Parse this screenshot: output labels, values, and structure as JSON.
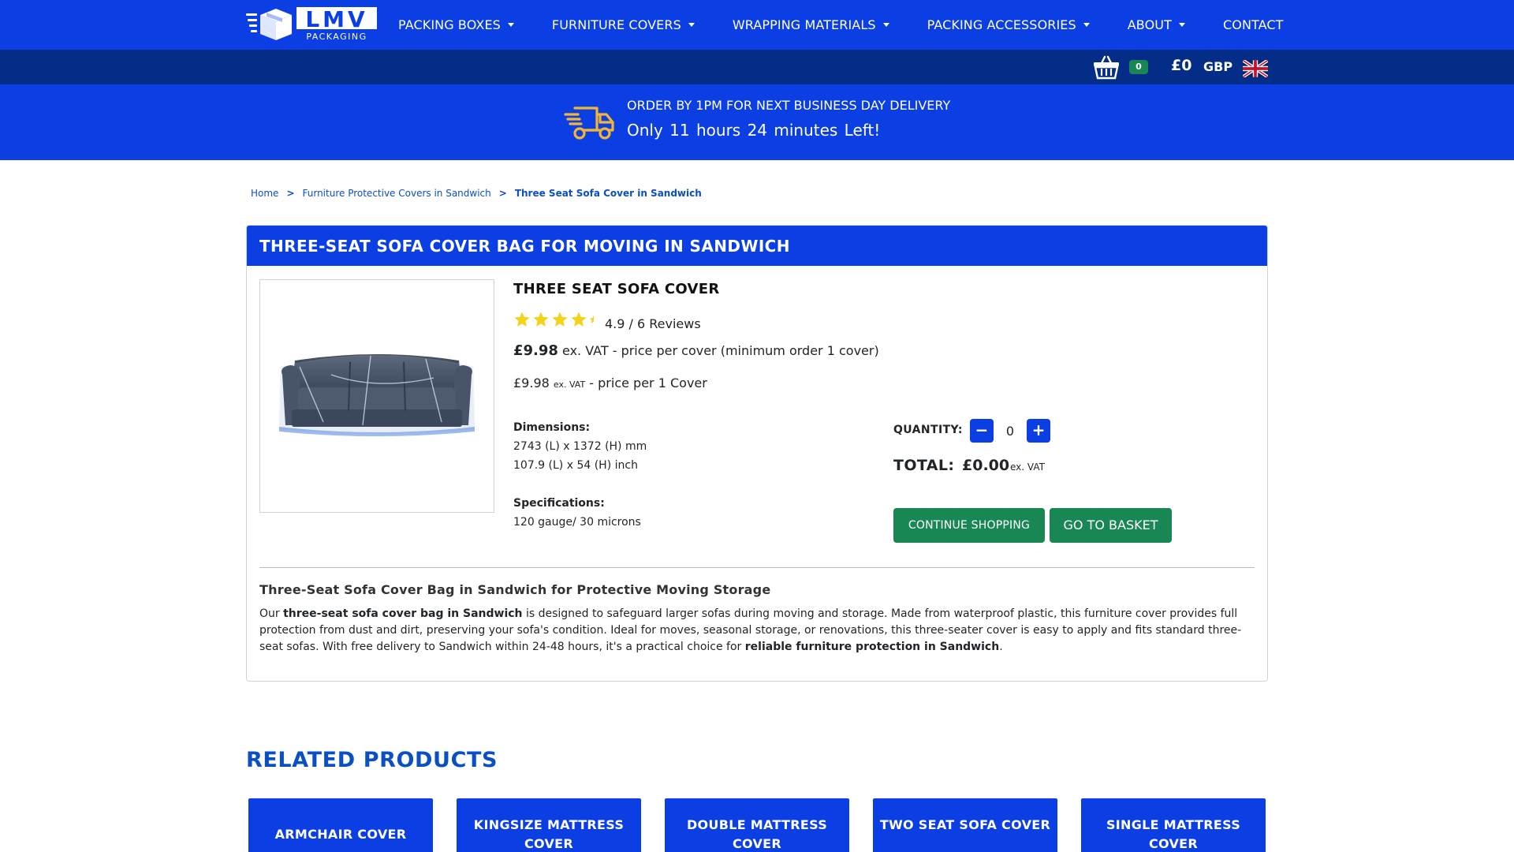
{
  "header": {
    "brand_main": "LMV",
    "brand_sub": "PACKAGING",
    "menu": [
      {
        "label": "PACKING BOXES",
        "dropdown": true
      },
      {
        "label": "FURNITURE COVERS",
        "dropdown": true
      },
      {
        "label": "WRAPPING MATERIALS",
        "dropdown": true
      },
      {
        "label": "PACKING ACCESSORIES",
        "dropdown": true
      },
      {
        "label": "ABOUT",
        "dropdown": true
      },
      {
        "label": "CONTACT",
        "dropdown": false
      }
    ]
  },
  "basket": {
    "count": "0",
    "total": "£0",
    "currency": "GBP",
    "icon": "basket-icon",
    "flag": "uk-flag-icon"
  },
  "delivery": {
    "icon": "delivery-truck-icon",
    "line1": "ORDER BY 1PM FOR NEXT BUSINESS DAY DELIVERY",
    "line2": "Only  11 hours 24 minutes  Left!"
  },
  "breadcrumb": [
    {
      "label": "Home"
    },
    {
      "label": "Furniture Protective Covers in Sandwich"
    },
    {
      "label": "Three Seat Sofa Cover in Sandwich"
    }
  ],
  "breadcrumb_sep": ">",
  "product": {
    "page_title": "THREE-SEAT SOFA COVER BAG FOR MOVING IN SANDWICH",
    "name": "THREE SEAT SOFA COVER",
    "rating": 4.9,
    "rating_text": "4.9 / 6 Reviews",
    "price": "£9.98",
    "price_suffix": " ex. VAT - price per cover (minimum order 1 cover)",
    "unit_price": "£9.98",
    "unit_exvat": "ex. VAT",
    "unit_suffix": " - price per 1 Cover",
    "dimensions_title": "Dimensions:",
    "dimensions_mm": "2743 (L) x 1372 (H) mm",
    "dimensions_inch": "107.9 (L) x 54 (H) inch",
    "spec_title": "Specifications:",
    "spec_value": "120 gauge/ 30 microns"
  },
  "order": {
    "qty_label": "QUANTITY:",
    "qty_value": "0",
    "minus": "−",
    "plus": "+",
    "total_label": "TOTAL:",
    "total_value": "£0.00",
    "total_exvat": "ex. VAT",
    "continue_label": "CONTINUE SHOPPING",
    "basket_label": "GO TO BASKET"
  },
  "description": {
    "title": "Three-Seat Sofa Cover Bag in Sandwich for Protective Moving Storage",
    "p1": "Our ",
    "b1": "three-seat sofa cover bag in Sandwich",
    "p2": " is designed to safeguard larger sofas during moving and storage. Made from waterproof plastic, this furniture cover provides full protection from dust and dirt, preserving your sofa's condition. Ideal for moves, seasonal storage, or renovations, this three-seater cover is easy to apply and fits standard three-seat sofas. With free delivery to Sandwich within 24-48 hours, it's a practical choice for ",
    "b2": "reliable furniture protection in Sandwich",
    "p3": "."
  },
  "related": {
    "title": "RELATED PRODUCTS",
    "items": [
      {
        "label": "ARMCHAIR COVER"
      },
      {
        "label": "KINGSIZE MATTRESS COVER"
      },
      {
        "label": "DOUBLE MATTRESS COVER"
      },
      {
        "label": "TWO SEAT SOFA COVER"
      },
      {
        "label": "SINGLE MATTRESS COVER"
      }
    ]
  },
  "colors": {
    "primary": "#0b3ee3",
    "dark_bar": "#032d86",
    "success": "#198754",
    "star": "#f5d31b",
    "truck": "#f2b632"
  }
}
